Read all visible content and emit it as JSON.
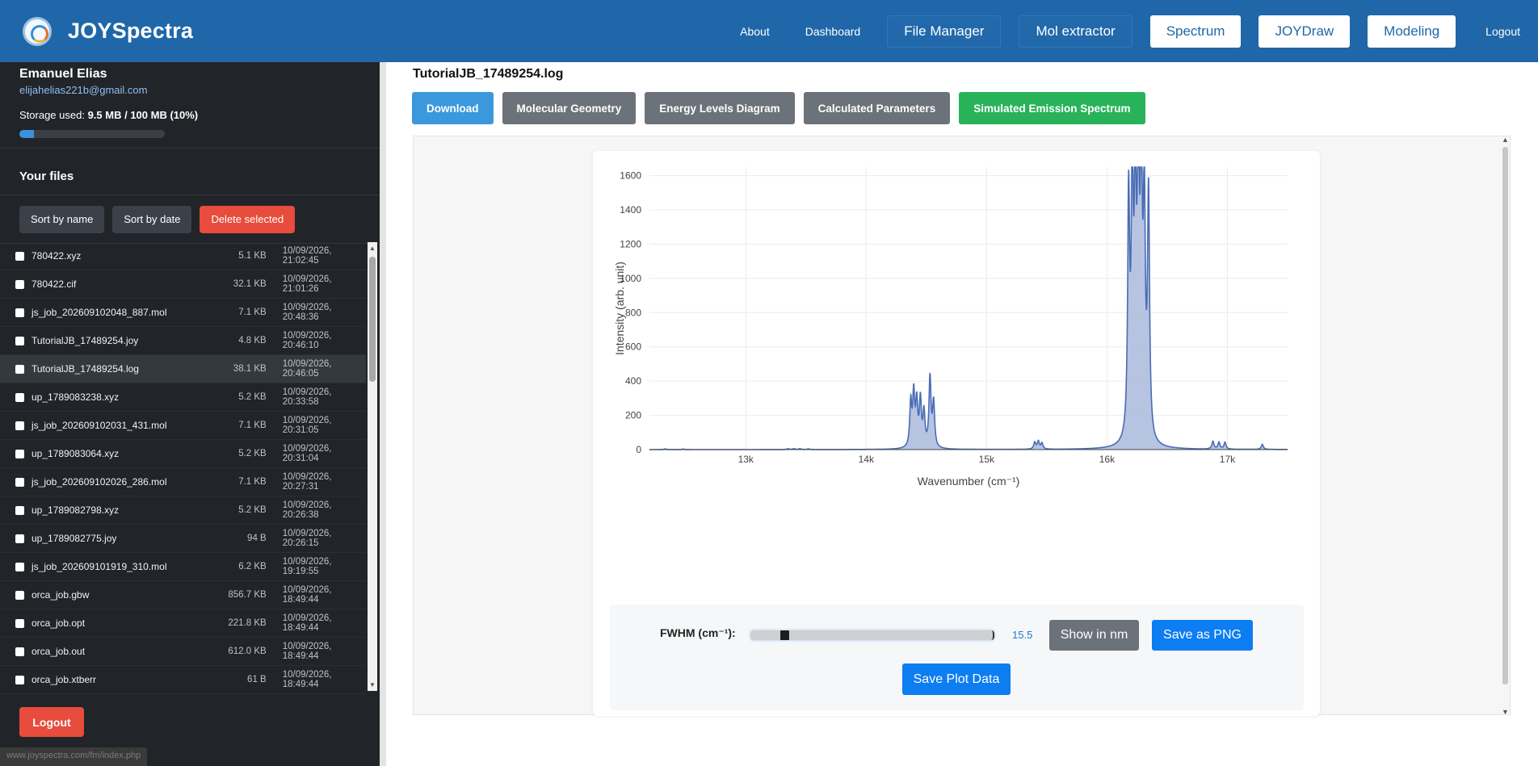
{
  "app": {
    "name": "JOYSpectra"
  },
  "nav": {
    "about": "About",
    "dashboard": "Dashboard",
    "file_manager": "File Manager",
    "mol_extractor": "Mol extractor",
    "spectrum": "Spectrum",
    "joydraw": "JOYDraw",
    "modeling": "Modeling",
    "logout": "Logout"
  },
  "user": {
    "name": "Emanuel Elias",
    "email": "elijahelias221b@gmail.com",
    "storage_label": "Storage used:",
    "storage_value": "9.5 MB / 100 MB (10%)",
    "storage_fraction": 0.1
  },
  "files": {
    "heading": "Your files",
    "sort_name": "Sort by name",
    "sort_date": "Sort by date",
    "delete_selected": "Delete selected",
    "items": [
      {
        "name": "780422.xyz",
        "size": "5.1 KB",
        "date": "10/09/2026, 21:02:45"
      },
      {
        "name": "780422.cif",
        "size": "32.1 KB",
        "date": "10/09/2026, 21:01:26"
      },
      {
        "name": "js_job_202609102048_887.mol",
        "size": "7.1 KB",
        "date": "10/09/2026, 20:48:36"
      },
      {
        "name": "TutorialJB_17489254.joy",
        "size": "4.8 KB",
        "date": "10/09/2026, 20:46:10"
      },
      {
        "name": "TutorialJB_17489254.log",
        "size": "38.1 KB",
        "date": "10/09/2026, 20:46:05"
      },
      {
        "name": "up_1789083238.xyz",
        "size": "5.2 KB",
        "date": "10/09/2026, 20:33:58"
      },
      {
        "name": "js_job_202609102031_431.mol",
        "size": "7.1 KB",
        "date": "10/09/2026, 20:31:05"
      },
      {
        "name": "up_1789083064.xyz",
        "size": "5.2 KB",
        "date": "10/09/2026, 20:31:04"
      },
      {
        "name": "js_job_202609102026_286.mol",
        "size": "7.1 KB",
        "date": "10/09/2026, 20:27:31"
      },
      {
        "name": "up_1789082798.xyz",
        "size": "5.2 KB",
        "date": "10/09/2026, 20:26:38"
      },
      {
        "name": "up_1789082775.joy",
        "size": "94 B",
        "date": "10/09/2026, 20:26:15"
      },
      {
        "name": "js_job_202609101919_310.mol",
        "size": "6.2 KB",
        "date": "10/09/2026, 19:19:55"
      },
      {
        "name": "orca_job.gbw",
        "size": "856.7 KB",
        "date": "10/09/2026, 18:49:44"
      },
      {
        "name": "orca_job.opt",
        "size": "221.8 KB",
        "date": "10/09/2026, 18:49:44"
      },
      {
        "name": "orca_job.out",
        "size": "612.0 KB",
        "date": "10/09/2026, 18:49:44"
      },
      {
        "name": "orca_job.xtberr",
        "size": "61 B",
        "date": "10/09/2026, 18:49:44"
      }
    ],
    "active_index": 4
  },
  "sidebar": {
    "logout": "Logout"
  },
  "status_url": "www.joyspectra.com/fm/index.php",
  "main": {
    "file_title": "TutorialJB_17489254.log",
    "actions": {
      "download": "Download",
      "molecular_geometry": "Molecular Geometry",
      "energy_levels": "Energy Levels Diagram",
      "calculated_parameters": "Calculated Parameters",
      "simulated_emission": "Simulated Emission Spectrum"
    }
  },
  "controls": {
    "fwhm_label": "FWHM (cm⁻¹):",
    "fwhm_value": "15.5",
    "fwhm_fraction": 0.14,
    "show_nm": "Show in nm",
    "save_png": "Save as PNG",
    "save_plot_data": "Save Plot Data"
  },
  "colors": {
    "navbar": "#1f67a8",
    "sidebar": "#212429",
    "accent_blue": "#3b98dd",
    "green": "#28b35a",
    "red": "#e74c3c",
    "series": "#4a6cb5"
  },
  "chart_data": {
    "type": "area",
    "xlabel": "Wavenumber (cm⁻¹)",
    "ylabel": "Intensity (arb. unit)",
    "xlim": [
      12200,
      17500
    ],
    "ylim": [
      0,
      1650
    ],
    "x_ticks": [
      13000,
      14000,
      15000,
      16000,
      17000
    ],
    "x_tick_labels": [
      "13k",
      "14k",
      "15k",
      "16k",
      "17k"
    ],
    "y_ticks": [
      0,
      200,
      400,
      600,
      800,
      1000,
      1200,
      1400,
      1600
    ],
    "y_tick_labels": [
      "0",
      "200",
      "400",
      "600",
      "800",
      "1000",
      "1200",
      "1400",
      "1600"
    ],
    "grid": true,
    "series": [
      {
        "peaks": [
          {
            "x": 12330,
            "y": 4
          },
          {
            "x": 12480,
            "y": 3
          },
          {
            "x": 13350,
            "y": 5
          },
          {
            "x": 13400,
            "y": 5
          },
          {
            "x": 13450,
            "y": 5
          },
          {
            "x": 13520,
            "y": 4
          },
          {
            "x": 14370,
            "y": 260
          },
          {
            "x": 14395,
            "y": 300
          },
          {
            "x": 14420,
            "y": 250
          },
          {
            "x": 14450,
            "y": 270
          },
          {
            "x": 14480,
            "y": 200
          },
          {
            "x": 14530,
            "y": 405
          },
          {
            "x": 14560,
            "y": 260
          },
          {
            "x": 15400,
            "y": 40
          },
          {
            "x": 15430,
            "y": 45
          },
          {
            "x": 15460,
            "y": 35
          },
          {
            "x": 16180,
            "y": 1390
          },
          {
            "x": 16210,
            "y": 1500
          },
          {
            "x": 16235,
            "y": 1360
          },
          {
            "x": 16260,
            "y": 1580
          },
          {
            "x": 16285,
            "y": 1570
          },
          {
            "x": 16310,
            "y": 1300
          },
          {
            "x": 16345,
            "y": 1410
          },
          {
            "x": 16880,
            "y": 45
          },
          {
            "x": 16930,
            "y": 40
          },
          {
            "x": 16980,
            "y": 40
          },
          {
            "x": 17290,
            "y": 30
          }
        ]
      }
    ]
  }
}
